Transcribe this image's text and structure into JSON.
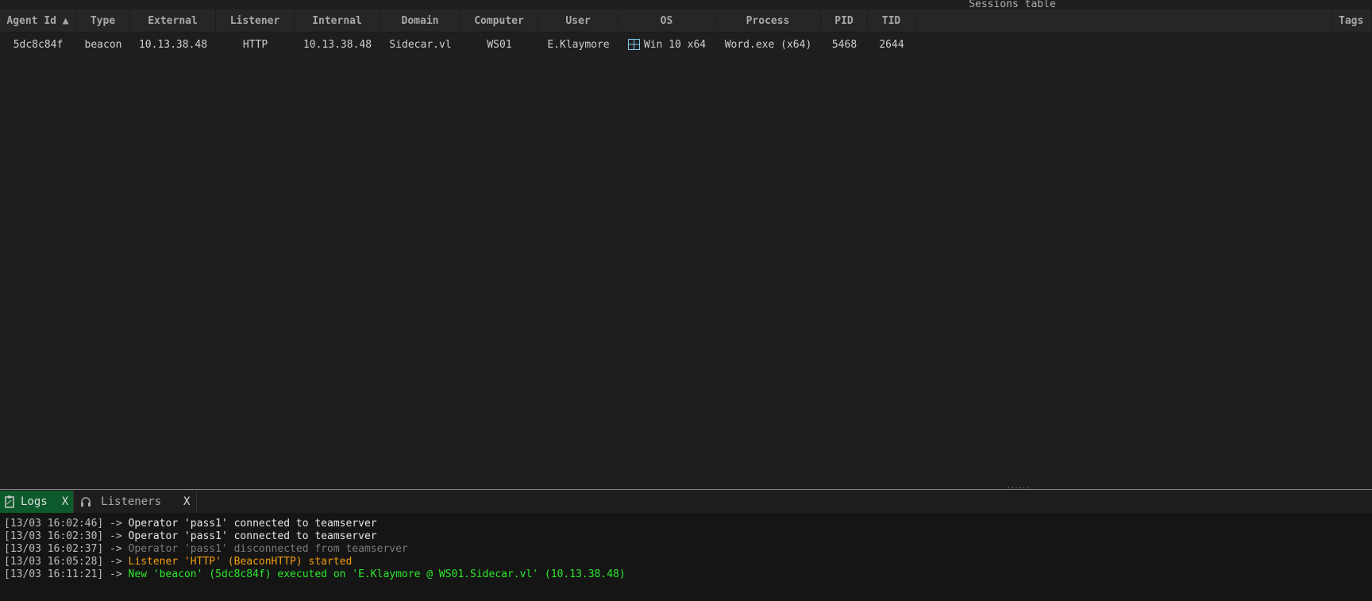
{
  "title": "Sessions table",
  "columns": [
    {
      "label": "Agent Id ▲",
      "w": 96
    },
    {
      "label": "Type",
      "w": 68
    },
    {
      "label": "External",
      "w": 108
    },
    {
      "label": "Listener",
      "w": 99
    },
    {
      "label": "Internal",
      "w": 108
    },
    {
      "label": "Domain",
      "w": 101
    },
    {
      "label": "Computer",
      "w": 98
    },
    {
      "label": "User",
      "w": 101
    },
    {
      "label": "OS",
      "w": 122
    },
    {
      "label": "Process",
      "w": 133
    },
    {
      "label": "PID",
      "w": 59
    },
    {
      "label": "TID",
      "w": 60
    },
    {
      "label": "",
      "w": 525
    },
    {
      "label": "Tags",
      "w": 50
    }
  ],
  "rows": [
    [
      "5dc8c84f",
      "beacon",
      "10.13.38.48",
      "HTTP",
      "10.13.38.48",
      "Sidecar.vl",
      "WS01",
      "E.Klaymore",
      "Win 10 x64",
      "Word.exe (x64)",
      "5468",
      "2644",
      "",
      ""
    ]
  ],
  "tabs": [
    {
      "label": "Logs",
      "icon": "clipboard-icon",
      "close": "X"
    },
    {
      "label": "Listeners",
      "icon": "headphones-icon",
      "close": "X"
    }
  ],
  "logs": [
    {
      "ts": "[13/03 16:02:46] ->",
      "msg": " Operator 'pass1' connected to teamserver",
      "color": "#e6e6e6"
    },
    {
      "ts": "[13/03 16:02:30] ->",
      "msg": " Operator 'pass1' connected to teamserver",
      "color": "#e6e6e6"
    },
    {
      "ts": "[13/03 16:02:37] ->",
      "msg": " Operator 'pass1' disconnected from teamserver",
      "color": "#7a7a7a"
    },
    {
      "ts": "[13/03 16:05:28] ->",
      "msg": " Listener 'HTTP' (BeaconHTTP) started",
      "color": "#f29d0f"
    },
    {
      "ts": "[13/03 16:11:21] ->",
      "msg": " New 'beacon' (5dc8c84f) executed on 'E.Klaymore @ WS01.Sidecar.vl' (10.13.38.48)",
      "color": "#2ee82e"
    }
  ]
}
